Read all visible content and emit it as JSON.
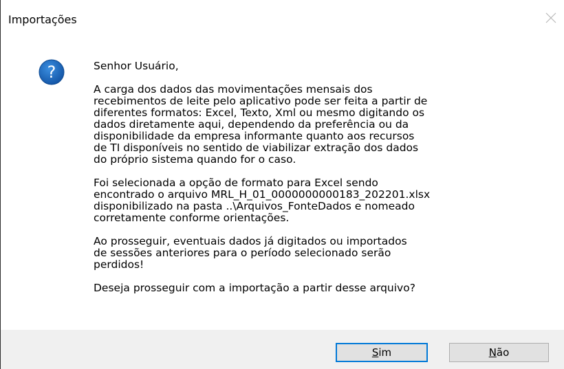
{
  "window": {
    "title": "Importações"
  },
  "icon": {
    "name": "question-icon",
    "color": "#1c63b8"
  },
  "message": {
    "greeting": "Senhor Usuário,",
    "paragraph1": "A carga dos dados das movimentações mensais dos\nrecebimentos de leite pelo aplicativo pode ser feita a partir de\ndiferentes formatos: Excel, Texto, Xml ou mesmo digitando os\ndados diretamente aqui, dependendo da preferência ou da\ndisponibilidade da empresa informante quanto aos recursos\nde TI disponíveis no sentido de viabilizar extração dos dados\ndo próprio sistema quando for o caso.",
    "paragraph2": "Foi selecionada a opção de formato para Excel sendo\nencontrado o arquivo MRL_H_01_0000000000183_202201.xlsx\ndisponibilizado na pasta ..\\Arquivos_FonteDados e nomeado\ncorretamente conforme orientações.",
    "paragraph3": "Ao prosseguir, eventuais dados já digitados ou importados\nde sessões anteriores para o período selecionado serão\nperdidos!",
    "question": "Deseja prosseguir com a importação a partir desse arquivo?"
  },
  "buttons": {
    "yes": {
      "mnemonic": "S",
      "rest": "im"
    },
    "no": {
      "mnemonic": "N",
      "rest": "ão"
    }
  },
  "colors": {
    "footer_bg": "#f0f0f0",
    "default_button_border": "#0078d7"
  }
}
